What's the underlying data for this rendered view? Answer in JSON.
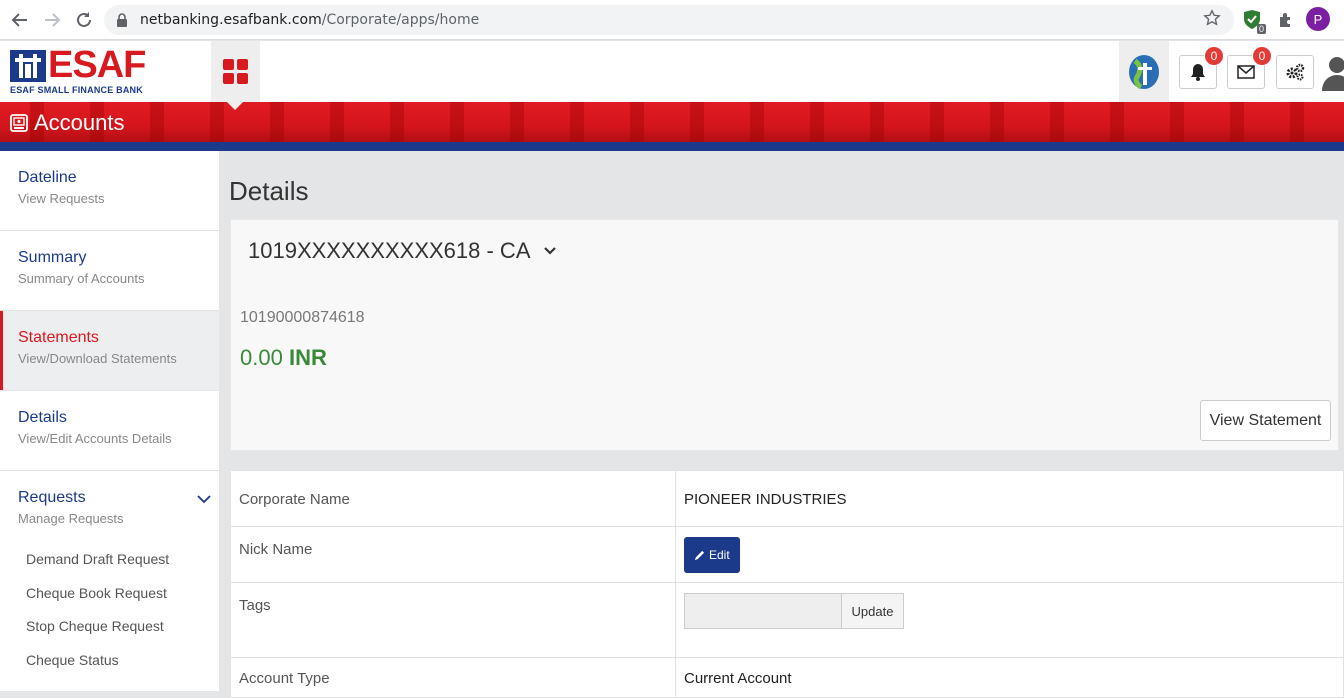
{
  "browser": {
    "url_host": "netbanking.esafbank.com",
    "url_path": "/Corporate/apps/home",
    "extension_badge": "0",
    "profile_initial": "P"
  },
  "header": {
    "logo_word": "ESAF",
    "logo_sub": "ESAF SMALL FINANCE BANK",
    "notifications_count": "0",
    "messages_count": "0"
  },
  "band": {
    "title": "Accounts"
  },
  "sidebar": {
    "items": [
      {
        "title": "Dateline",
        "subtitle": "View Requests"
      },
      {
        "title": "Summary",
        "subtitle": "Summary of Accounts"
      },
      {
        "title": "Statements",
        "subtitle": "View/Download Statements"
      },
      {
        "title": "Details",
        "subtitle": "View/Edit Accounts Details"
      },
      {
        "title": "Requests",
        "subtitle": "Manage Requests"
      }
    ],
    "sub_items": [
      "Demand Draft Request",
      "Cheque Book Request",
      "Stop Cheque Request",
      "Cheque Status"
    ]
  },
  "main": {
    "page_title": "Details",
    "account_selected": "1019XXXXXXXXXX618 - CA",
    "account_number": "10190000874618",
    "balance_amount": "0.00",
    "balance_currency": "INR",
    "view_statement_label": "View Statement",
    "details": {
      "corporate_name_label": "Corporate Name",
      "corporate_name_value": "PIONEER INDUSTRIES",
      "nick_name_label": "Nick Name",
      "edit_label": "Edit",
      "tags_label": "Tags",
      "tags_value": "",
      "update_label": "Update",
      "account_type_label": "Account Type",
      "account_type_value": "Current Account"
    }
  },
  "colors": {
    "brand_red": "#d71920",
    "brand_blue": "#1b3a8a",
    "balance_green": "#3a8a3a"
  }
}
